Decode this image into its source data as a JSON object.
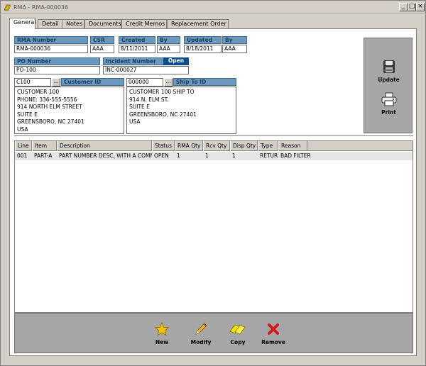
{
  "window": {
    "title": "RMA - RMA-000036",
    "min_glyph": "_",
    "max_glyph": "□",
    "close_glyph": "×"
  },
  "tabs": [
    {
      "label": "General",
      "active": true
    },
    {
      "label": "Detail"
    },
    {
      "label": "Notes"
    },
    {
      "label": "Documents"
    },
    {
      "label": "Credit Memos"
    },
    {
      "label": "Replacement Order"
    }
  ],
  "header": {
    "rma_number_label": "RMA Number",
    "rma_number": "RMA-000036",
    "csr_label": "CSR",
    "csr": "AAA",
    "created_label": "Created",
    "created": "8/11/2011",
    "created_by_label": "By",
    "created_by": "AAA",
    "updated_label": "Updated",
    "updated": "8/18/2011",
    "updated_by_label": "By",
    "updated_by": "AAA",
    "po_number_label": "PO Number",
    "po_number": "PO-100",
    "incident_number_label": "Incident Number",
    "incident_number": "INC-000027",
    "status": "Open"
  },
  "customer": {
    "code": "C100",
    "lookup_glyph": "...",
    "label": "Customer ID",
    "address": "CUSTOMER 100\nPHONE: 336-555-5556\n914 NORTH ELM STREET\nSUITE E\nGREENSBORO, NC 27401\nUSA"
  },
  "shipto": {
    "code": "000000",
    "lookup_glyph": "...",
    "label": "Ship To ID",
    "address": "CUSTOMER 100 SHIP TO\n914 N. ELM ST.\nSUITE E\nGREENSBORO, NC 27401\nUSA"
  },
  "actions": {
    "update_label": "Update",
    "print_label": "Print"
  },
  "grid": {
    "columns": [
      "Line",
      "Item",
      "Description",
      "Status",
      "RMA Qty",
      "Rcv Qty",
      "Disp Qty",
      "Type",
      "Reason"
    ],
    "rows": [
      [
        "001",
        "PART-A",
        "PART NUMBER DESC, WITH A COMMA",
        "OPEN",
        "1",
        "1",
        "1",
        "RETURN",
        "BAD FILTER"
      ]
    ]
  },
  "toolbar": {
    "new_label": "New",
    "modify_label": "Modify",
    "copy_label": "Copy",
    "remove_label": "Remove"
  },
  "colors": {
    "label_bg": "#6c98bd",
    "status_bg": "#0b4f8a",
    "panel_gray": "#a7a6a6"
  }
}
